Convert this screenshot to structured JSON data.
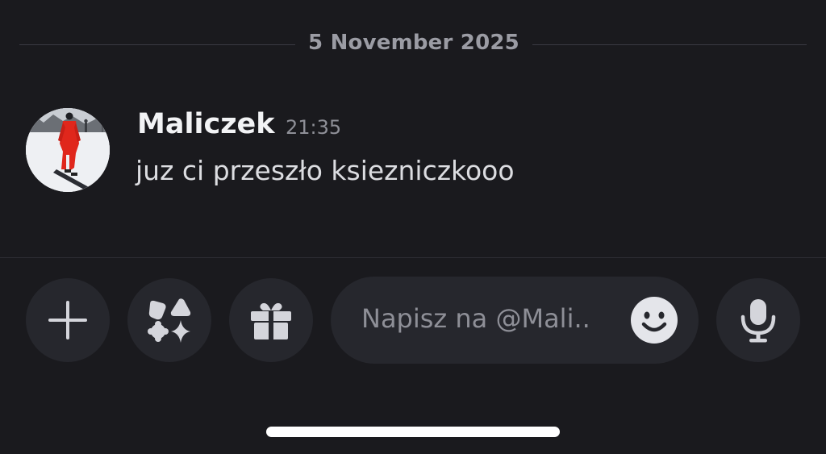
{
  "date_divider": {
    "label": "5 November 2025"
  },
  "message": {
    "author": "Maliczek",
    "time": "21:35",
    "text": "juz ci przeszło ksiezniczkooo"
  },
  "composer": {
    "placeholder": "Napisz na @Mali..",
    "buttons": {
      "plus": "plus-icon",
      "apps": "apps-icon",
      "gift": "gift-icon",
      "emoji": "emoji-icon",
      "mic": "microphone-icon"
    }
  },
  "colors": {
    "background": "#1a1a1e",
    "button_bg": "#26272d",
    "icon": "#d4d5db",
    "muted_text": "#8e8f97"
  }
}
